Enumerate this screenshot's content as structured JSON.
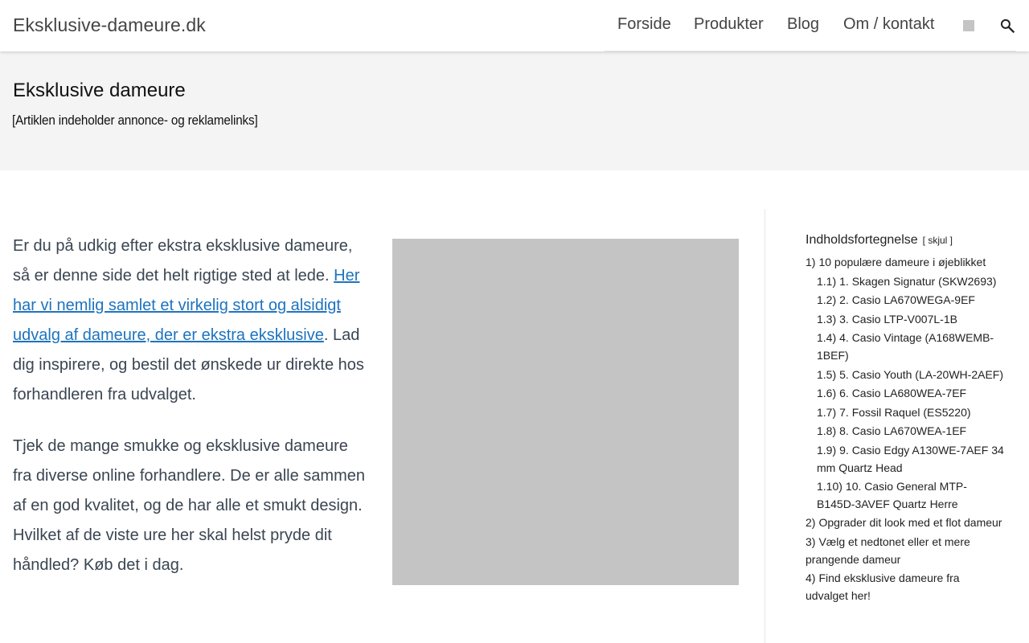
{
  "header": {
    "site_title": "Eksklusive-dameure.dk",
    "nav": [
      {
        "label": "Forside"
      },
      {
        "label": "Produkter"
      },
      {
        "label": "Blog"
      },
      {
        "label": "Om / kontakt"
      }
    ]
  },
  "hero": {
    "title": "Eksklusive dameure",
    "disclaimer": "[Artiklen indeholder annonce- og reklamelinks]"
  },
  "article": {
    "p1_text_before": "Er du på udkig efter ekstra eksklusive dameure, så er denne side det helt rigtige sted at lede. ",
    "p1_link": "Her har vi nemlig samlet et virkelig stort og alsidigt udvalg af dameure, der er ekstra eksklusive",
    "p1_text_after": ". Lad dig inspirere, og bestil det ønskede ur direkte hos forhandleren fra udvalget.",
    "p2": "Tjek de mange smukke og eksklusive dameure fra diverse online forhandlere. De er alle sammen af en god kvalitet, og de har alle et smukt design. Hvilket af de viste ure her skal helst pryde dit håndled? Køb det i dag."
  },
  "toc": {
    "title": "Indholdsfortegnelse",
    "toggle_open": "[ ",
    "toggle_label": "skjul",
    "toggle_close": " ]",
    "items": [
      {
        "num": "1)",
        "label": "10 populære dameure i øjeblikket"
      },
      {
        "num": "1.1)",
        "label": "1. Skagen Signatur (SKW2693)"
      },
      {
        "num": "1.2)",
        "label": "2. Casio LA670WEGA-9EF"
      },
      {
        "num": "1.3)",
        "label": "3. Casio LTP-V007L-1B"
      },
      {
        "num": "1.4)",
        "label": "4. Casio Vintage (A168WEMB-1BEF)"
      },
      {
        "num": "1.5)",
        "label": "5. Casio Youth (LA-20WH-2AEF)"
      },
      {
        "num": "1.6)",
        "label": "6. Casio LA680WEA-7EF"
      },
      {
        "num": "1.7)",
        "label": "7. Fossil Raquel (ES5220)"
      },
      {
        "num": "1.8)",
        "label": "8. Casio LA670WEA-1EF"
      },
      {
        "num": "1.9)",
        "label": "9. Casio Edgy A130WE-7AEF 34 mm Quartz Head"
      },
      {
        "num": "1.10)",
        "label": "10. Casio General MTP-B145D-3AVEF Quartz Herre"
      },
      {
        "num": "2)",
        "label": "Opgrader dit look med et flot dameur"
      },
      {
        "num": "3)",
        "label": "Vælg et nedtonet eller et mere prangende dameur"
      },
      {
        "num": "4)",
        "label": "Find eksklusive dameure fra udvalget her!"
      }
    ]
  },
  "icons": {
    "search": "search-icon",
    "nav_square": "placeholder-square-icon"
  },
  "colors": {
    "link": "#1e73be",
    "hero_bg": "#f4f4f4",
    "placeholder": "#c4c4c4"
  }
}
